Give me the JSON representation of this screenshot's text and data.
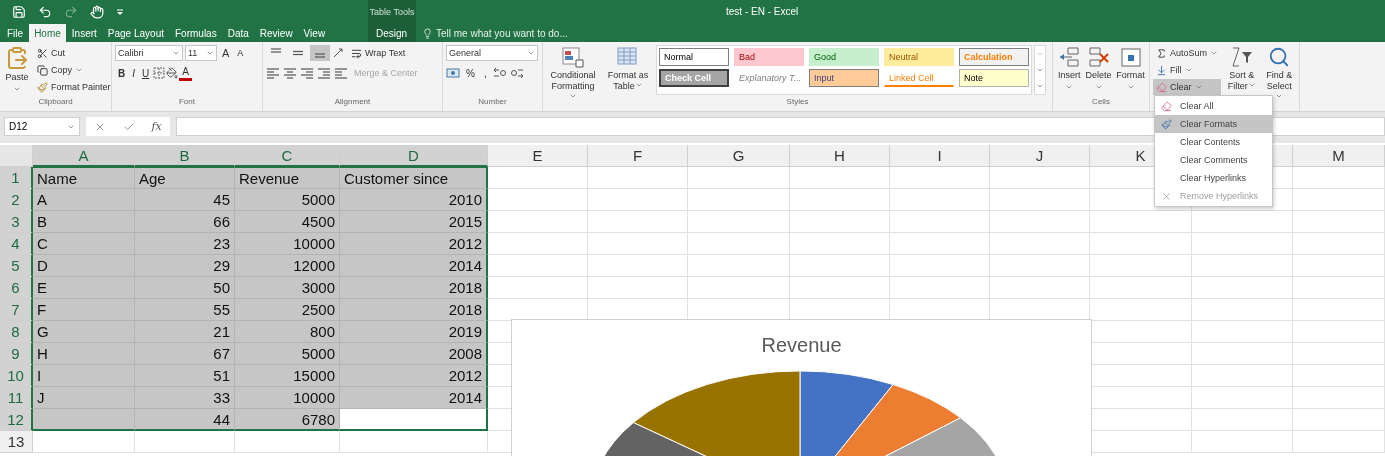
{
  "title_bar": {
    "title": "test - EN - Excel",
    "contextual": {
      "label": "Table Tools",
      "tabs": [
        {
          "label": "Design",
          "selected": false
        }
      ]
    },
    "tell_me": "Tell me what you want to do..."
  },
  "tabs": [
    {
      "label": "File",
      "selected": false
    },
    {
      "label": "Home",
      "selected": true
    },
    {
      "label": "Insert",
      "selected": false
    },
    {
      "label": "Page Layout",
      "selected": false
    },
    {
      "label": "Formulas",
      "selected": false
    },
    {
      "label": "Data",
      "selected": false
    },
    {
      "label": "Review",
      "selected": false
    },
    {
      "label": "View",
      "selected": false
    }
  ],
  "ribbon": {
    "clipboard": {
      "paste": "Paste",
      "cut": "Cut",
      "copy": "Copy",
      "format_painter": "Format Painter",
      "label": "Clipboard"
    },
    "font": {
      "name": "Calibri",
      "size": "11",
      "grow": "A",
      "shrink": "A",
      "bold": "B",
      "italic": "I",
      "underline": "U",
      "font_color": "A",
      "label": "Font"
    },
    "alignment": {
      "vertical": [
        {
          "selected": false
        },
        {
          "selected": false
        },
        {
          "selected": true
        }
      ],
      "wrap_text": "Wrap Text",
      "merge": {
        "label": "Merge & Center",
        "disabled": true
      },
      "label": "Alignment"
    },
    "number": {
      "format": "General",
      "percent": "%",
      "comma": ",",
      "label": "Number"
    },
    "styles": {
      "conditional": "Conditional Formatting",
      "format_table": "Format as Table",
      "label": "Styles",
      "cells": [
        {
          "label": "Normal",
          "kind": "normal",
          "color": "#ffffff"
        },
        {
          "label": "Bad",
          "kind": "bad",
          "color": "#ffc7ce"
        },
        {
          "label": "Good",
          "kind": "good",
          "color": "#c6efce"
        },
        {
          "label": "Neutral",
          "kind": "neutral",
          "color": "#ffeb9c"
        },
        {
          "label": "Calculation",
          "kind": "calculation",
          "color": "#f2f2f2"
        },
        {
          "label": "Check Cell",
          "kind": "check",
          "color": "#a5a5a5"
        },
        {
          "label": "Explanatory T...",
          "kind": "explanatory",
          "color": "#ffffff"
        },
        {
          "label": "Input",
          "kind": "input",
          "color": "#ffcc99"
        },
        {
          "label": "Linked Cell",
          "kind": "linked",
          "color": "#ffffff"
        },
        {
          "label": "Note",
          "kind": "note",
          "color": "#ffffcc"
        }
      ]
    },
    "cells": {
      "insert": "Insert",
      "delete": "Delete",
      "format": "Format",
      "label": "Cells"
    },
    "editing": {
      "autosum": "AutoSum",
      "fill": "Fill",
      "clear": {
        "label": "Clear",
        "expanded": true
      },
      "sort": "Sort & Filter",
      "find": "Find & Select"
    }
  },
  "clear_menu": [
    {
      "label": "Clear All",
      "selected": false,
      "disabled": false
    },
    {
      "label": "Clear Formats",
      "selected": true,
      "disabled": false
    },
    {
      "label": "Clear Contents",
      "selected": false,
      "disabled": false
    },
    {
      "label": "Clear Comments",
      "selected": false,
      "disabled": false
    },
    {
      "label": "Clear Hyperlinks",
      "selected": false,
      "disabled": false
    },
    {
      "label": "Remove Hyperlinks",
      "selected": false,
      "disabled": true
    }
  ],
  "formula_bar": {
    "name_box": "D12",
    "function": "fx"
  },
  "sheet": {
    "columns": [
      {
        "label": "A",
        "selected": true
      },
      {
        "label": "B",
        "selected": true
      },
      {
        "label": "C",
        "selected": true
      },
      {
        "label": "D",
        "selected": true
      },
      {
        "label": "E",
        "selected": false
      },
      {
        "label": "F",
        "selected": false
      },
      {
        "label": "G",
        "selected": false
      },
      {
        "label": "H",
        "selected": false
      },
      {
        "label": "I",
        "selected": false
      },
      {
        "label": "J",
        "selected": false
      },
      {
        "label": "K",
        "selected": false
      },
      {
        "selected": false
      },
      {
        "label": "M",
        "selected": false
      }
    ],
    "rows": [
      {
        "number": "1",
        "selected": true,
        "cells": [
          {
            "kind": "text",
            "value": "Name",
            "active": false
          },
          {
            "kind": "text",
            "value": "Age",
            "active": false
          },
          {
            "kind": "text",
            "value": "Revenue",
            "active": false
          },
          {
            "kind": "text",
            "value": "Customer since",
            "active": false
          }
        ]
      },
      {
        "number": "2",
        "selected": true,
        "cells": [
          {
            "kind": "text",
            "value": "A",
            "active": false
          },
          {
            "kind": "number",
            "value": "45",
            "active": false
          },
          {
            "kind": "number",
            "value": "5000",
            "active": false
          },
          {
            "kind": "number",
            "value": "2010",
            "active": false
          }
        ]
      },
      {
        "number": "3",
        "selected": true,
        "cells": [
          {
            "kind": "text",
            "value": "B",
            "active": false
          },
          {
            "kind": "number",
            "value": "66",
            "active": false
          },
          {
            "kind": "number",
            "value": "4500",
            "active": false
          },
          {
            "kind": "number",
            "value": "2015",
            "active": false
          }
        ]
      },
      {
        "number": "4",
        "selected": true,
        "cells": [
          {
            "kind": "text",
            "value": "C",
            "active": false
          },
          {
            "kind": "number",
            "value": "23",
            "active": false
          },
          {
            "kind": "number",
            "value": "10000",
            "active": false
          },
          {
            "kind": "number",
            "value": "2012",
            "active": false
          }
        ]
      },
      {
        "number": "5",
        "selected": true,
        "cells": [
          {
            "kind": "text",
            "value": "D",
            "active": false
          },
          {
            "kind": "number",
            "value": "29",
            "active": false
          },
          {
            "kind": "number",
            "value": "12000",
            "active": false
          },
          {
            "kind": "number",
            "value": "2014",
            "active": false
          }
        ]
      },
      {
        "number": "6",
        "selected": true,
        "cells": [
          {
            "kind": "text",
            "value": "E",
            "active": false
          },
          {
            "kind": "number",
            "value": "50",
            "active": false
          },
          {
            "kind": "number",
            "value": "3000",
            "active": false
          },
          {
            "kind": "number",
            "value": "2018",
            "active": false
          }
        ]
      },
      {
        "number": "7",
        "selected": true,
        "cells": [
          {
            "kind": "text",
            "value": "F",
            "active": false
          },
          {
            "kind": "number",
            "value": "55",
            "active": false
          },
          {
            "kind": "number",
            "value": "2500",
            "active": false
          },
          {
            "kind": "number",
            "value": "2018",
            "active": false
          }
        ]
      },
      {
        "number": "8",
        "selected": true,
        "cells": [
          {
            "kind": "text",
            "value": "G",
            "active": false
          },
          {
            "kind": "number",
            "value": "21",
            "active": false
          },
          {
            "kind": "number",
            "value": "800",
            "active": false
          },
          {
            "kind": "number",
            "value": "2019",
            "active": false
          }
        ]
      },
      {
        "number": "9",
        "selected": true,
        "cells": [
          {
            "kind": "text",
            "value": "H",
            "active": false
          },
          {
            "kind": "number",
            "value": "67",
            "active": false
          },
          {
            "kind": "number",
            "value": "5000",
            "active": false
          },
          {
            "kind": "number",
            "value": "2008",
            "active": false
          }
        ]
      },
      {
        "number": "10",
        "selected": true,
        "cells": [
          {
            "kind": "text",
            "value": "I",
            "active": false
          },
          {
            "kind": "number",
            "value": "51",
            "active": false
          },
          {
            "kind": "number",
            "value": "15000",
            "active": false
          },
          {
            "kind": "number",
            "value": "2012",
            "active": false
          }
        ]
      },
      {
        "number": "11",
        "selected": true,
        "cells": [
          {
            "kind": "text",
            "value": "J",
            "active": false
          },
          {
            "kind": "number",
            "value": "33",
            "active": false
          },
          {
            "kind": "number",
            "value": "10000",
            "active": false
          },
          {
            "kind": "number",
            "value": "2014",
            "active": false
          }
        ]
      },
      {
        "number": "12",
        "selected": true,
        "cells": [
          {
            "kind": "blank",
            "active": false
          },
          {
            "kind": "number",
            "value": "44",
            "active": false
          },
          {
            "kind": "number",
            "value": "6780",
            "active": false
          },
          {
            "kind": "blank",
            "active": true
          }
        ]
      },
      {
        "number": "13",
        "selected": false,
        "cells": []
      }
    ]
  },
  "chart": {
    "title": "Revenue"
  }
}
